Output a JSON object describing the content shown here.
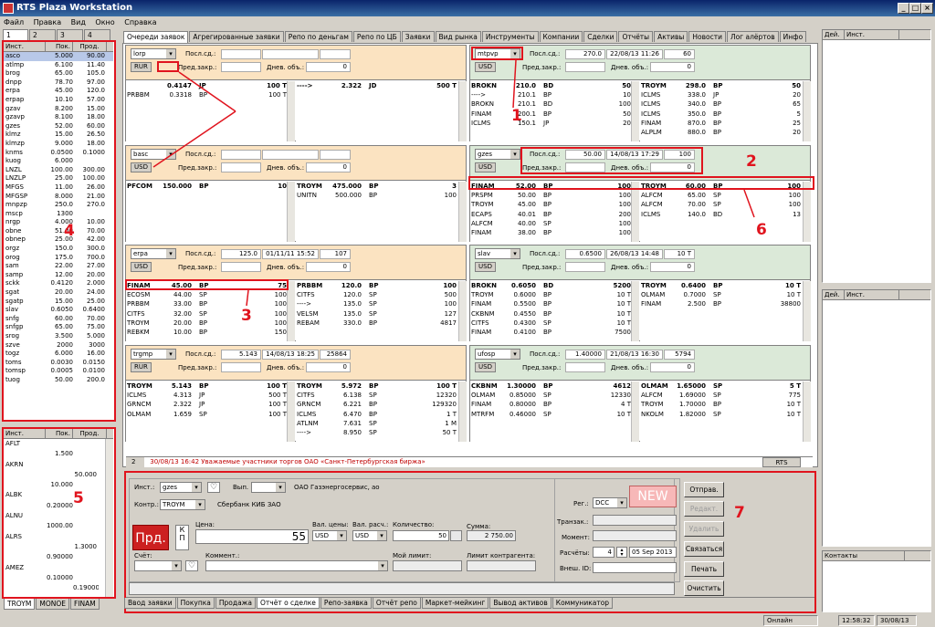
{
  "title": "RTS Plaza Workstation",
  "menu": [
    "Файл",
    "Правка",
    "Вид",
    "Окно",
    "Справка"
  ],
  "left": {
    "tabs": [
      "1",
      "2",
      "3",
      "4"
    ],
    "headers": [
      "Инст.",
      "Пок.",
      "Прод."
    ],
    "rows": [
      [
        "asco",
        "5.000",
        "90.00"
      ],
      [
        "atlmp",
        "6.100",
        "11.40"
      ],
      [
        "brog",
        "65.00",
        "105.0"
      ],
      [
        "dnpp",
        "78.70",
        "97.00"
      ],
      [
        "erpa",
        "45.00",
        "120.0"
      ],
      [
        "erpap",
        "10.10",
        "57.00"
      ],
      [
        "gzav",
        "8.200",
        "15.00"
      ],
      [
        "gzavp",
        "8.100",
        "18.00"
      ],
      [
        "gzes",
        "52.00",
        "60.00"
      ],
      [
        "klmz",
        "15.00",
        "26.50"
      ],
      [
        "klmzp",
        "9.000",
        "18.00"
      ],
      [
        "knms",
        "0.0500",
        "0.1000"
      ],
      [
        "kuog",
        "6.000",
        ""
      ],
      [
        "LNZL",
        "100.00",
        "300.00"
      ],
      [
        "LNZLP",
        "25.00",
        "100.00"
      ],
      [
        "MFGS",
        "11.00",
        "26.00"
      ],
      [
        "MFGSP",
        "8.000",
        "21.00"
      ],
      [
        "mnpzp",
        "250.0",
        "270.0"
      ],
      [
        "mscp",
        "1300",
        ""
      ],
      [
        "nrgp",
        "4.000",
        "10.00"
      ],
      [
        "obne",
        "51.00",
        "70.00"
      ],
      [
        "obnep",
        "25.00",
        "42.00"
      ],
      [
        "orgz",
        "150.0",
        "300.0"
      ],
      [
        "orog",
        "175.0",
        "700.0"
      ],
      [
        "sam",
        "22.00",
        "27.00"
      ],
      [
        "samp",
        "12.00",
        "20.00"
      ],
      [
        "sckk",
        "0.4120",
        "2.000"
      ],
      [
        "sgat",
        "20.00",
        "24.00"
      ],
      [
        "sgatp",
        "15.00",
        "25.00"
      ],
      [
        "slav",
        "0.6050",
        "0.6400"
      ],
      [
        "snfg",
        "60.00",
        "70.00"
      ],
      [
        "snfgp",
        "65.00",
        "75.00"
      ],
      [
        "srog",
        "3.500",
        "5.000"
      ],
      [
        "szve",
        "2000",
        "3000"
      ],
      [
        "togz",
        "6.000",
        "16.00"
      ],
      [
        "toms",
        "0.0030",
        "0.0150"
      ],
      [
        "tomsp",
        "0.0005",
        "0.0100"
      ],
      [
        "tuog",
        "50.00",
        "200.0"
      ]
    ],
    "marker": "4"
  },
  "left2": {
    "headers": [
      "Инст.",
      "Пок.",
      "Прод."
    ],
    "rows": [
      [
        "AFLT",
        "",
        ""
      ],
      [
        "",
        "1.500",
        ""
      ],
      [
        "AKRN",
        "",
        ""
      ],
      [
        "",
        "",
        "50.000"
      ],
      [
        "",
        "10.000",
        ""
      ],
      [
        "ALBK",
        "",
        ""
      ],
      [
        "",
        "0.20000",
        ""
      ],
      [
        "ALNU",
        "",
        ""
      ],
      [
        "",
        "1000.00",
        ""
      ],
      [
        "ALRS",
        "",
        ""
      ],
      [
        "",
        "",
        "1.3000"
      ],
      [
        "",
        "0.90000",
        ""
      ],
      [
        "AMEZ",
        "",
        ""
      ],
      [
        "",
        "0.10000",
        ""
      ],
      [
        "",
        "",
        "0.19000"
      ]
    ],
    "tabs": [
      "TROYM",
      "MONOE",
      "FINAM"
    ],
    "marker": "5"
  },
  "center_tabs": [
    "Очереди заявок",
    "Агрегированные заявки",
    "Репо по деньгам",
    "Репо по ЦБ",
    "Заявки",
    "Вид рынка",
    "Инструменты",
    "Компании",
    "Сделки",
    "Отчёты",
    "Активы",
    "Новости",
    "Лог алёртов",
    "Инфо"
  ],
  "labels": {
    "last": "Посл.сд.:",
    "prev": "Пред.закр.:",
    "vol": "Днев. объ.:"
  },
  "quotes": [
    {
      "ticker": "lorp",
      "cur": "RUR",
      "last_price": "",
      "last_date": "",
      "last_qty": "",
      "prev": "",
      "vol": "0",
      "color": "orange",
      "bids": [
        [
          "",
          "0.4147",
          "JP",
          "100 T"
        ],
        [
          "PRBBM",
          "0.3318",
          "BP",
          "100 T"
        ]
      ],
      "asks": [
        [
          "---->",
          "2.322",
          "JD",
          "500 T"
        ]
      ]
    },
    {
      "ticker": "mtpvp",
      "cur": "USD",
      "last_price": "270.0",
      "last_date": "22/08/13 11:26",
      "last_qty": "60",
      "prev": "",
      "vol": "0",
      "color": "green",
      "bids": [
        [
          "BROKN",
          "210.0",
          "BD",
          "50"
        ],
        [
          "---->",
          "210.1",
          "BP",
          "10"
        ],
        [
          "BROKN",
          "210.1",
          "BD",
          "100"
        ],
        [
          "FINAM",
          "200.1",
          "BP",
          "50"
        ],
        [
          "ICLMS",
          "150.1",
          "JP",
          "20"
        ]
      ],
      "asks": [
        [
          "TROYM",
          "298.0",
          "BP",
          "50"
        ],
        [
          "ICLMS",
          "338.0",
          "JP",
          "20"
        ],
        [
          "ICLMS",
          "340.0",
          "BP",
          "65"
        ],
        [
          "ICLMS",
          "350.0",
          "BP",
          "5"
        ],
        [
          "FINAM",
          "870.0",
          "BP",
          "25"
        ],
        [
          "ALPLM",
          "880.0",
          "BP",
          "20"
        ]
      ]
    },
    {
      "ticker": "basc",
      "cur": "USD",
      "last_price": "",
      "last_date": "",
      "last_qty": "",
      "prev": "",
      "vol": "0",
      "color": "orange",
      "bids": [
        [
          "PFCOM",
          "150.000",
          "BP",
          "10"
        ]
      ],
      "asks": [
        [
          "TROYM",
          "475.000",
          "BP",
          "3"
        ],
        [
          "UNITN",
          "500.000",
          "BP",
          "100"
        ]
      ]
    },
    {
      "ticker": "gzes",
      "cur": "USD",
      "last_price": "50.00",
      "last_date": "14/08/13 17:29",
      "last_qty": "100",
      "prev": "",
      "vol": "0",
      "color": "green",
      "bids": [
        [
          "FINAM",
          "52.00",
          "BP",
          "100"
        ],
        [
          "PRSPM",
          "50.00",
          "BP",
          "100"
        ],
        [
          "TROYM",
          "45.00",
          "BP",
          "100"
        ],
        [
          "ECAPS",
          "40.01",
          "BP",
          "200"
        ],
        [
          "ALFCM",
          "40.00",
          "SP",
          "100"
        ],
        [
          "FINAM",
          "38.00",
          "BP",
          "100"
        ]
      ],
      "asks": [
        [
          "TROYM",
          "60.00",
          "BP",
          "100"
        ],
        [
          "ALFCM",
          "65.00",
          "SP",
          "100"
        ],
        [
          "ALFCM",
          "70.00",
          "SP",
          "100"
        ],
        [
          "ICLMS",
          "140.0",
          "BD",
          "13"
        ]
      ]
    },
    {
      "ticker": "erpa",
      "cur": "USD",
      "last_price": "125.0",
      "last_date": "01/11/11 15:52",
      "last_qty": "107",
      "prev": "",
      "vol": "0",
      "color": "orange",
      "bids": [
        [
          "FINAM",
          "45.00",
          "BP",
          "75"
        ],
        [
          "ECOSM",
          "44.00",
          "SP",
          "100"
        ],
        [
          "PRBBM",
          "33.00",
          "BP",
          "100"
        ],
        [
          "CITFS",
          "32.00",
          "SP",
          "100"
        ],
        [
          "TROYM",
          "20.00",
          "BP",
          "100"
        ],
        [
          "REBKM",
          "10.00",
          "BP",
          "150"
        ]
      ],
      "asks": [
        [
          "PRBBM",
          "120.0",
          "BP",
          "100"
        ],
        [
          "CITFS",
          "120.0",
          "SP",
          "500"
        ],
        [
          "---->",
          "135.0",
          "SP",
          "100"
        ],
        [
          "VELSM",
          "135.0",
          "SP",
          "127"
        ],
        [
          "REBAM",
          "330.0",
          "BP",
          "4817"
        ]
      ]
    },
    {
      "ticker": "slav",
      "cur": "USD",
      "last_price": "0.6500",
      "last_date": "26/08/13 14:48",
      "last_qty": "10 T",
      "prev": "",
      "vol": "0",
      "color": "green",
      "bids": [
        [
          "BROKN",
          "0.6050",
          "BD",
          "5200"
        ],
        [
          "TROYM",
          "0.6000",
          "BP",
          "10 T"
        ],
        [
          "FINAM",
          "0.5500",
          "BP",
          "10 T"
        ],
        [
          "CKBNM",
          "0.4550",
          "BP",
          "10 T"
        ],
        [
          "CITFS",
          "0.4300",
          "SP",
          "10 T"
        ],
        [
          "FINAM",
          "0.4100",
          "BP",
          "7500"
        ]
      ],
      "asks": [
        [
          "TROYM",
          "0.6400",
          "BP",
          "10 T"
        ],
        [
          "OLMAM",
          "0.7000",
          "SP",
          "10 T"
        ],
        [
          "FINAM",
          "2.500",
          "BP",
          "38800"
        ]
      ]
    },
    {
      "ticker": "trgmp",
      "cur": "RUR",
      "last_price": "5.143",
      "last_date": "14/08/13 18:25",
      "last_qty": "25864",
      "prev": "",
      "vol": "0",
      "color": "orange",
      "bids": [
        [
          "TROYM",
          "5.143",
          "BP",
          "100 T"
        ],
        [
          "ICLMS",
          "4.313",
          "JP",
          "500 T"
        ],
        [
          "GRNCM",
          "2.322",
          "JP",
          "100 T"
        ],
        [
          "OLMAM",
          "1.659",
          "SP",
          "100 T"
        ]
      ],
      "asks": [
        [
          "TROYM",
          "5.972",
          "BP",
          "100 T"
        ],
        [
          "CITFS",
          "6.138",
          "SP",
          "12320"
        ],
        [
          "GRNCM",
          "6.221",
          "BP",
          "129320"
        ],
        [
          "ICLMS",
          "6.470",
          "BP",
          "1 T"
        ],
        [
          "ATLNM",
          "7.631",
          "SP",
          "1 M"
        ],
        [
          "---->",
          "8.950",
          "SP",
          "50 T"
        ]
      ]
    },
    {
      "ticker": "ufosp",
      "cur": "USD",
      "last_price": "1.40000",
      "last_date": "21/08/13 16:30",
      "last_qty": "5794",
      "prev": "",
      "vol": "0",
      "color": "green",
      "bids": [
        [
          "CKBNM",
          "1.30000",
          "BP",
          "4612"
        ],
        [
          "OLMAM",
          "0.85000",
          "SP",
          "12330"
        ],
        [
          "FINAM",
          "0.80000",
          "BP",
          "4 T"
        ],
        [
          "MTRFM",
          "0.46000",
          "SP",
          "10 T"
        ]
      ],
      "asks": [
        [
          "OLMAM",
          "1.65000",
          "SP",
          "5 T"
        ],
        [
          "ALFCM",
          "1.69000",
          "SP",
          "775"
        ],
        [
          "TROYM",
          "1.70000",
          "BP",
          "10 T"
        ],
        [
          "NKOLM",
          "1.82000",
          "SP",
          "10 T"
        ]
      ]
    }
  ],
  "news": {
    "num": "2",
    "text": "30/08/13 16:42  Уважаемые участники торгов ОАО «Санкт-Петербургская биржа»",
    "tag": "RTS"
  },
  "order": {
    "inst_label": "Инст.:",
    "inst": "gzes",
    "vyp_label": "Вып.",
    "inst_desc": "ОАО Газэнергосервис, ао",
    "kontr_label": "Контр.:",
    "kontr": "TROYM",
    "kontr_desc": "Сбербанк КИБ ЗАО",
    "side": "Прд.",
    "kp": "К\nП",
    "price_label": "Цена:",
    "price": "55",
    "curp_label": "Вал. цены:",
    "curp": "USD",
    "curs_label": "Вал. расч.:",
    "curs": "USD",
    "qty_label": "Количество:",
    "qty": "50",
    "sum_label": "Сумма:",
    "sum": "2 750.00",
    "acc_label": "Счёт:",
    "comment_label": "Коммент.:",
    "limit_label": "Мой лимит:",
    "climit_label": "Лимит контрагента:",
    "reg_label": "Рег.:",
    "reg": "DCC",
    "status": "NEW",
    "trans_label": "Транзак.:",
    "moment_label": "Момент:",
    "calc_label": "Расчёты:",
    "calc_days": "4",
    "calc_date": "05 Sep 2013",
    "ext_label": "Внеш. ID:",
    "buttons": [
      "Отправ.",
      "Редакт.",
      "Удалить",
      "Связаться",
      "Печать",
      "Очистить"
    ],
    "marker": "7"
  },
  "bottom_tabs": [
    "Ввод заявки",
    "Покупка",
    "Продажа",
    "Отчёт о сделке",
    "Репо-заявка",
    "Отчёт репо",
    "Маркет-мейкинг",
    "Вывод активов",
    "Коммуникатор"
  ],
  "right": {
    "h1": [
      "Дей.",
      "Инст."
    ],
    "h2": [
      "Дей.",
      "Инст."
    ],
    "h3": "Контакты"
  },
  "status": {
    "online": "Онлайн",
    "time": "12:58:32",
    "date": "30/08/13"
  },
  "markers": [
    "1",
    "2",
    "3",
    "6"
  ]
}
